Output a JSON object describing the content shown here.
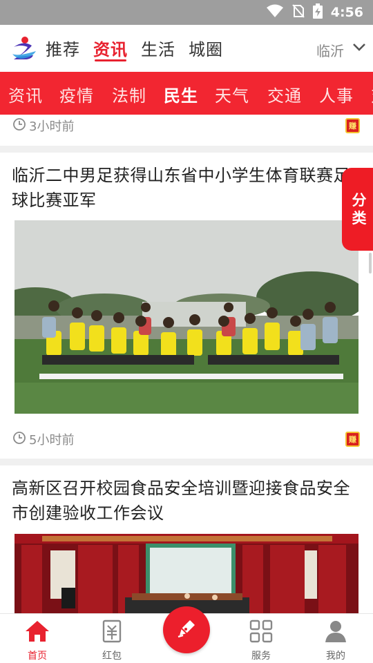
{
  "status_bar": {
    "time": "4:56"
  },
  "top_nav": {
    "tabs": [
      {
        "label": "推荐"
      },
      {
        "label": "资讯"
      },
      {
        "label": "生活"
      },
      {
        "label": "城圈"
      }
    ],
    "active_tab": "资讯",
    "city": "临沂"
  },
  "category_bar": {
    "items": [
      "资讯",
      "疫情",
      "法制",
      "民生",
      "天气",
      "交通",
      "人事",
      "对"
    ],
    "active": "民生"
  },
  "feed": {
    "top_meta": {
      "time": "3小时前"
    },
    "articles": [
      {
        "title": "临沂二中男足获得山东省中小学生体育联赛足球比赛亚军",
        "time": "5小时前"
      },
      {
        "title": "高新区召开校园食品安全培训暨迎接食品安全市创建验收工作会议"
      }
    ],
    "badge_text": "赚"
  },
  "side_float": {
    "label_line1": "分",
    "label_line2": "类"
  },
  "bottom_nav": {
    "items": [
      {
        "label": "首页",
        "icon": "home-icon"
      },
      {
        "label": "红包",
        "icon": "red-packet-icon"
      },
      {
        "label": "",
        "icon": "pen-icon"
      },
      {
        "label": "服务",
        "icon": "grid-icon"
      },
      {
        "label": "我的",
        "icon": "user-icon"
      }
    ]
  },
  "colors": {
    "accent": "#e8222f",
    "category_bar": "#f22631",
    "status_bar": "#9e9e9e"
  }
}
